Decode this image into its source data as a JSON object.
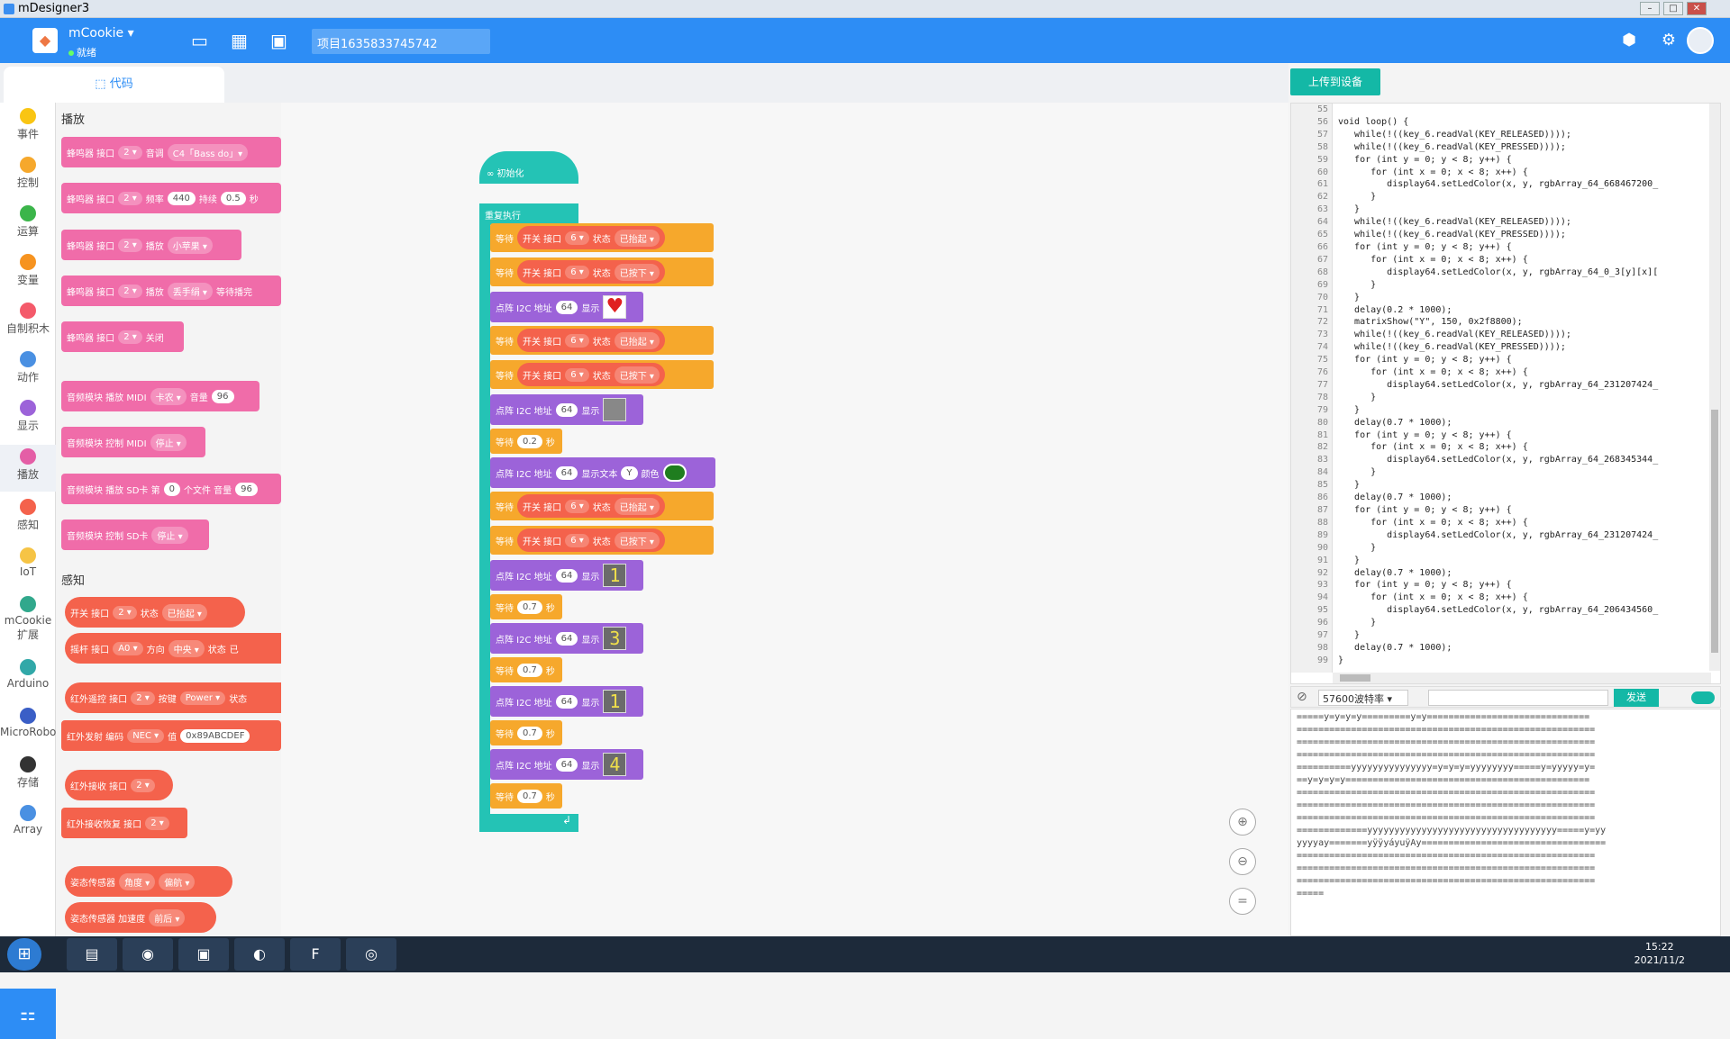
{
  "window": {
    "title": "mDesigner3"
  },
  "topbar": {
    "device": "mCookie",
    "status": "就绪",
    "project": "项目1635833745742"
  },
  "tabs": {
    "code": "代码"
  },
  "categories": [
    {
      "label": "事件",
      "color": "#f9c513"
    },
    {
      "label": "控制",
      "color": "#f6a82c"
    },
    {
      "label": "运算",
      "color": "#3bb54a"
    },
    {
      "label": "变量",
      "color": "#f69320"
    },
    {
      "label": "自制积木",
      "color": "#f45a6a"
    },
    {
      "label": "动作",
      "color": "#4a90e2"
    },
    {
      "label": "显示",
      "color": "#9c63d9"
    },
    {
      "label": "播放",
      "color": "#e45ea6"
    },
    {
      "label": "感知",
      "color": "#f4624c"
    },
    {
      "label": "IoT",
      "color": "#f6c445"
    },
    {
      "label": "mCookie 扩展",
      "color": "#31a88c"
    },
    {
      "label": "Arduino",
      "color": "#31a8a8"
    },
    {
      "label": "MicroRobot",
      "color": "#3a5ec6"
    },
    {
      "label": "存储",
      "color": "#333333"
    },
    {
      "label": "Array",
      "color": "#4a90e2"
    }
  ],
  "palette": {
    "sec_play": "播放",
    "sec_sense": "感知",
    "p1": {
      "a": "蜂鸣器 接口",
      "b": "2 ▾",
      "c": "音调",
      "d": "C4「Bass do」▾"
    },
    "p2": {
      "a": "蜂鸣器 接口",
      "b": "2 ▾",
      "c": "频率",
      "d": "440",
      "e": "持续",
      "f": "0.5",
      "g": "秒"
    },
    "p3": {
      "a": "蜂鸣器 接口",
      "b": "2 ▾",
      "c": "播放",
      "d": "小苹果 ▾"
    },
    "p4": {
      "a": "蜂鸣器 接口",
      "b": "2 ▾",
      "c": "播放",
      "d": "丢手绢 ▾",
      "e": "等待播完"
    },
    "p5": {
      "a": "蜂鸣器 接口",
      "b": "2 ▾",
      "c": "关闭"
    },
    "p6": {
      "a": "音频模块 播放 MIDI",
      "b": "卡农 ▾",
      "c": "音量",
      "d": "96"
    },
    "p7": {
      "a": "音频模块 控制 MIDI",
      "b": "停止 ▾"
    },
    "p8": {
      "a": "音频模块 播放 SD卡 第",
      "b": "0",
      "c": "个文件 音量",
      "d": "96"
    },
    "p9": {
      "a": "音频模块 控制 SD卡",
      "b": "停止 ▾"
    },
    "s1": {
      "a": "开关 接口",
      "b": "2 ▾",
      "c": "状态",
      "d": "已抬起 ▾"
    },
    "s2": {
      "a": "摇杆 接口",
      "b": "A0 ▾",
      "c": "方向",
      "d": "中央 ▾",
      "e": "状态",
      "f": "已"
    },
    "s3": {
      "a": "红外遥控 接口",
      "b": "2 ▾",
      "c": "按键",
      "d": "Power ▾",
      "e": "状态"
    },
    "s4": {
      "a": "红外发射 编码",
      "b": "NEC ▾",
      "c": "值",
      "d": "0x89ABCDEF"
    },
    "s5": {
      "a": "红外接收 接口",
      "b": "2 ▾"
    },
    "s6": {
      "a": "红外接收恢复 接口",
      "b": "2 ▾"
    },
    "s7": {
      "a": "姿态传感器",
      "b": "角度 ▾",
      "c": "偏航 ▾"
    },
    "s8": {
      "a": "姿态传感器 加速度",
      "b": "前后 ▾"
    }
  },
  "workspace": {
    "init": "初始化",
    "loop": "重复执行",
    "wait": "等待",
    "switch": "开关 接口",
    "port": "6 ▾",
    "state": "状态",
    "released": "已抬起 ▾",
    "pressed": "已按下 ▾",
    "matrix": "点阵 I2C 地址",
    "addr": "64",
    "show": "显示",
    "show_text": "显示文本",
    "text_val": "Y",
    "color": "颜色",
    "sec": "秒",
    "d1": "0.2",
    "d2": "0.7",
    "glyphs": {
      "g1": "1",
      "g2": "3",
      "g3": "1",
      "g4": "4"
    }
  },
  "right": {
    "upload": "上传到设备",
    "baud": "57600波特率 ▾",
    "send": "发送"
  },
  "code": {
    "lines": [
      "55",
      "56",
      "57",
      "58",
      "59",
      "60",
      "61",
      "62",
      "63",
      "64",
      "65",
      "66",
      "67",
      "68",
      "69",
      "70",
      "71",
      "72",
      "73",
      "74",
      "75",
      "76",
      "77",
      "78",
      "79",
      "80",
      "81",
      "82",
      "83",
      "84",
      "85",
      "86",
      "87",
      "88",
      "89",
      "90",
      "91",
      "92",
      "93",
      "94",
      "95",
      "96",
      "97",
      "98",
      "99"
    ],
    "text": "\nvoid loop() {\n   while(!((key_6.readVal(KEY_RELEASED))));\n   while(!((key_6.readVal(KEY_PRESSED))));\n   for (int y = 0; y < 8; y++) {\n      for (int x = 0; x < 8; x++) {\n         display64.setLedColor(x, y, rgbArray_64_668467200_\n      }\n   }\n   while(!((key_6.readVal(KEY_RELEASED))));\n   while(!((key_6.readVal(KEY_PRESSED))));\n   for (int y = 0; y < 8; y++) {\n      for (int x = 0; x < 8; x++) {\n         display64.setLedColor(x, y, rgbArray_64_0_3[y][x][\n      }\n   }\n   delay(0.2 * 1000);\n   matrixShow(\"Y\", 150, 0x2f8800);\n   while(!((key_6.readVal(KEY_RELEASED))));\n   while(!((key_6.readVal(KEY_PRESSED))));\n   for (int y = 0; y < 8; y++) {\n      for (int x = 0; x < 8; x++) {\n         display64.setLedColor(x, y, rgbArray_64_231207424_\n      }\n   }\n   delay(0.7 * 1000);\n   for (int y = 0; y < 8; y++) {\n      for (int x = 0; x < 8; x++) {\n         display64.setLedColor(x, y, rgbArray_64_268345344_\n      }\n   }\n   delay(0.7 * 1000);\n   for (int y = 0; y < 8; y++) {\n      for (int x = 0; x < 8; x++) {\n         display64.setLedColor(x, y, rgbArray_64_231207424_\n      }\n   }\n   delay(0.7 * 1000);\n   for (int y = 0; y < 8; y++) {\n      for (int x = 0; x < 8; x++) {\n         display64.setLedColor(x, y, rgbArray_64_206434560_\n      }\n   }\n   delay(0.7 * 1000);\n}"
  },
  "serial": [
    "=====y=y=y=y=========y=y==============================",
    "=======================================================",
    "=======================================================",
    "=======================================================",
    "==========yyyyyyyyyyyyyyy=y=y=y=yyyyyyyy=====y=yyyyy=y=",
    "==y=y=y=y=============================================",
    "=======================================================",
    "=======================================================",
    "=======================================================",
    "=============yyyyyyyyyyyyyyyyyyyyyyyyyyyyyyyyyyy=====y=yy",
    "yyyyay=======yÿÿyáyuÿAy==================================",
    "=======================================================",
    "=======================================================",
    "=======================================================",
    "====="
  ],
  "taskbar": {
    "time": "15:22",
    "date": "2021/11/2"
  }
}
